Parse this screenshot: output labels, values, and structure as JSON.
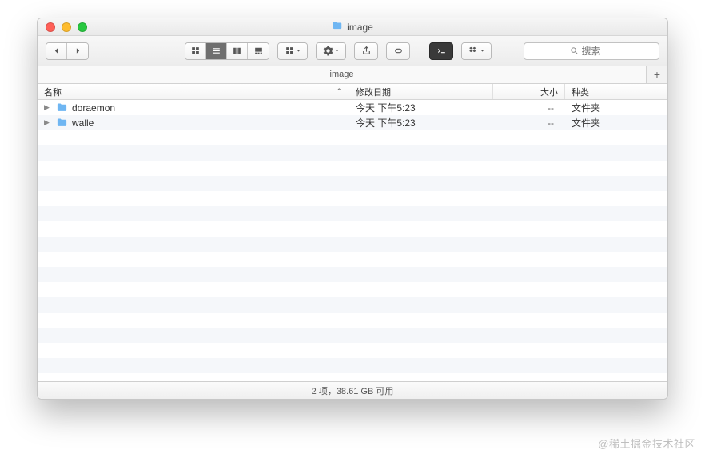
{
  "window": {
    "title": "image"
  },
  "tabs": {
    "active": "image"
  },
  "columns": {
    "name": "名称",
    "date": "修改日期",
    "size": "大小",
    "kind": "种类"
  },
  "rows": [
    {
      "name": "doraemon",
      "date": "今天 下午5:23",
      "size": "--",
      "kind": "文件夹"
    },
    {
      "name": "walle",
      "date": "今天 下午5:23",
      "size": "--",
      "kind": "文件夹"
    }
  ],
  "status": {
    "text": "2 项，38.61 GB 可用"
  },
  "search": {
    "placeholder": "搜索"
  },
  "watermark": "@稀土掘金技术社区"
}
